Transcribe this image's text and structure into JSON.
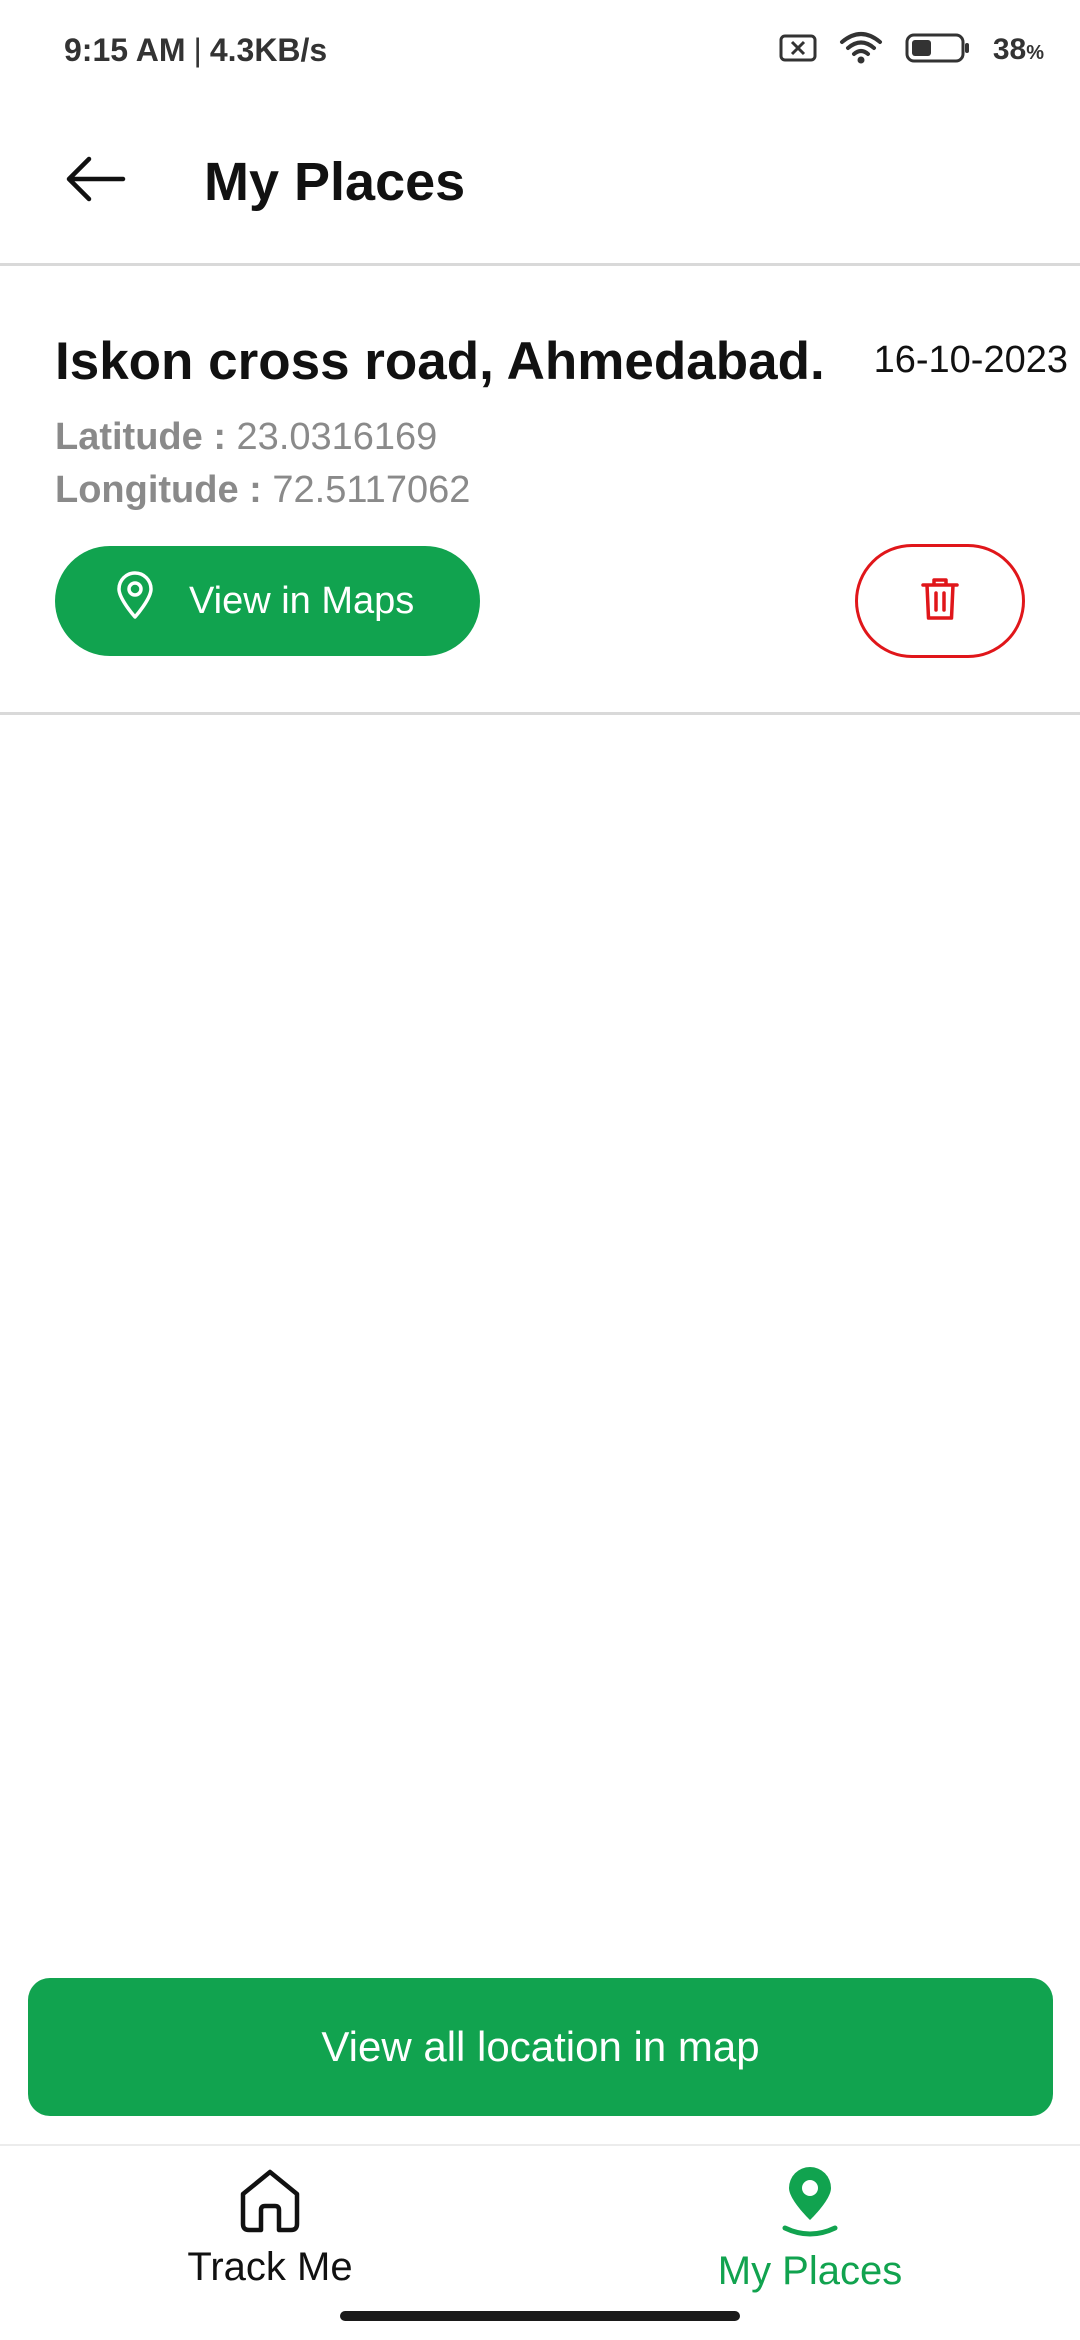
{
  "status_bar": {
    "time": "9:15 AM",
    "separator": "|",
    "speed": "4.3KB/s",
    "battery_percent": "38",
    "battery_unit": "%",
    "icons": [
      "sim-off-icon",
      "wifi-icon",
      "battery-icon"
    ]
  },
  "app_bar": {
    "back_icon": "arrow-left-icon",
    "title": "My Places"
  },
  "places": [
    {
      "name": "Iskon cross road, Ahmedabad.",
      "date": "16-10-2023",
      "latitude_label": "Latitude :",
      "latitude": "23.0316169",
      "longitude_label": "Longitude :",
      "longitude": "72.5117062",
      "view_button_label": "View in Maps",
      "view_button_icon": "location-pin-outline-icon",
      "delete_icon": "trash-icon"
    }
  ],
  "view_all_button": {
    "label": "View all location in map"
  },
  "bottom_nav": {
    "items": [
      {
        "label": "Track Me",
        "icon": "home-icon",
        "active": false
      },
      {
        "label": "My Places",
        "icon": "location-pin-filled-icon",
        "active": true
      }
    ]
  },
  "colors": {
    "accent_green": "#11a34f",
    "delete_red": "#e0161a",
    "secondary_text": "#8a8a8a",
    "divider": "#d9d9d9"
  }
}
